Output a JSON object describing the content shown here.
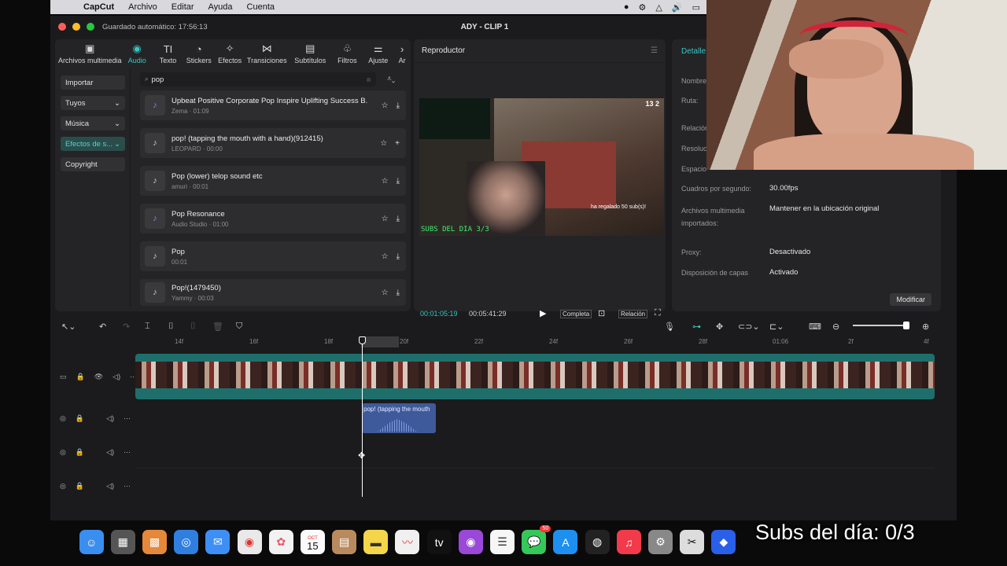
{
  "menubar": {
    "app": "CapCut",
    "items": [
      "Archivo",
      "Editar",
      "Ayuda",
      "Cuenta"
    ]
  },
  "window": {
    "autosave": "Guardado automático: 17:56:13",
    "title": "ADY - CLIP 1"
  },
  "toolbar": {
    "tools": [
      "Archivos multimedia",
      "Audio",
      "Texto",
      "Stickers",
      "Efectos",
      "Transiciones",
      "Subtítulos",
      "Filtros",
      "Ajuste",
      "Ar"
    ],
    "active": "Audio"
  },
  "categories": [
    {
      "label": "Importar",
      "active": false,
      "chevron": false
    },
    {
      "label": "Tuyos",
      "active": false,
      "chevron": true
    },
    {
      "label": "Música",
      "active": false,
      "chevron": true
    },
    {
      "label": "Efectos de s...",
      "active": true,
      "chevron": true
    },
    {
      "label": "Copyright",
      "active": false,
      "chevron": false
    }
  ],
  "search": {
    "value": "pop"
  },
  "tracks": [
    {
      "name": "Upbeat Positive Corporate Pop Inspire Uplifting Success B...",
      "meta": "Zema · 01:09",
      "purple": true,
      "action": "download"
    },
    {
      "name": "pop! (tapping the mouth with a hand)(912415)",
      "meta": "LEOPARD · 00:00",
      "purple": false,
      "action": "add"
    },
    {
      "name": "Pop (lower) telop sound etc",
      "meta": "amuri · 00:01",
      "purple": false,
      "action": "download"
    },
    {
      "name": "Pop Resonance",
      "meta": "Audio Studio · 01:00",
      "purple": true,
      "action": "download"
    },
    {
      "name": "Pop",
      "meta": "00:01",
      "purple": false,
      "action": "download"
    },
    {
      "name": "Pop!(1479450)",
      "meta": "Yammy · 00:03",
      "purple": false,
      "action": "download"
    }
  ],
  "player": {
    "title": "Reproductor",
    "current_time": "00:01:05:19",
    "total_time": "00:05:41:29",
    "btn_full": "Completa",
    "btn_ratio": "Relación",
    "video": {
      "green_text": "SUBS DEL DIA 3/3",
      "score": "13   2",
      "caption": "ha regalado 50 sub(s)!"
    }
  },
  "details": {
    "tab": "Detalle",
    "rows": [
      {
        "label": "Nombre",
        "value": ""
      },
      {
        "label": "Ruta:",
        "value": ""
      },
      {
        "label": "Relación",
        "value": ""
      },
      {
        "label": "Resolución",
        "value": ""
      },
      {
        "label": "Espacio",
        "value": ""
      },
      {
        "label": "Cuadros por segundo:",
        "value": "30.00fps"
      },
      {
        "label": "Archivos multimedia importados:",
        "value": "Mantener en la ubicación original"
      },
      {
        "label": "Proxy:",
        "value": "Desactivado"
      },
      {
        "label": "Disposición de capas",
        "value": "Activado"
      }
    ],
    "modify": "Modificar"
  },
  "timeline": {
    "ruler": [
      "14f",
      "16f",
      "18f",
      "20f",
      "22f",
      "24f",
      "26f",
      "28f",
      "01:06",
      "2f",
      "4f"
    ],
    "audio_clip": "pop! (tapping the mouth"
  },
  "dock": {
    "date_month": "OCT",
    "date_day": "15",
    "badge": "50",
    "apps": [
      "finder",
      "launchpad",
      "photos",
      "safari",
      "mail",
      "chrome",
      "photos-app",
      "calendar",
      "contacts",
      "notes",
      "freeform",
      "appletv",
      "podcasts",
      "reminders",
      "messages",
      "appstore",
      "obs",
      "music",
      "settings",
      "capcut",
      "other",
      "spotify",
      "capcut-2",
      "discord",
      "trash"
    ]
  },
  "overlay": {
    "text": "Subs del día: 0/3"
  }
}
